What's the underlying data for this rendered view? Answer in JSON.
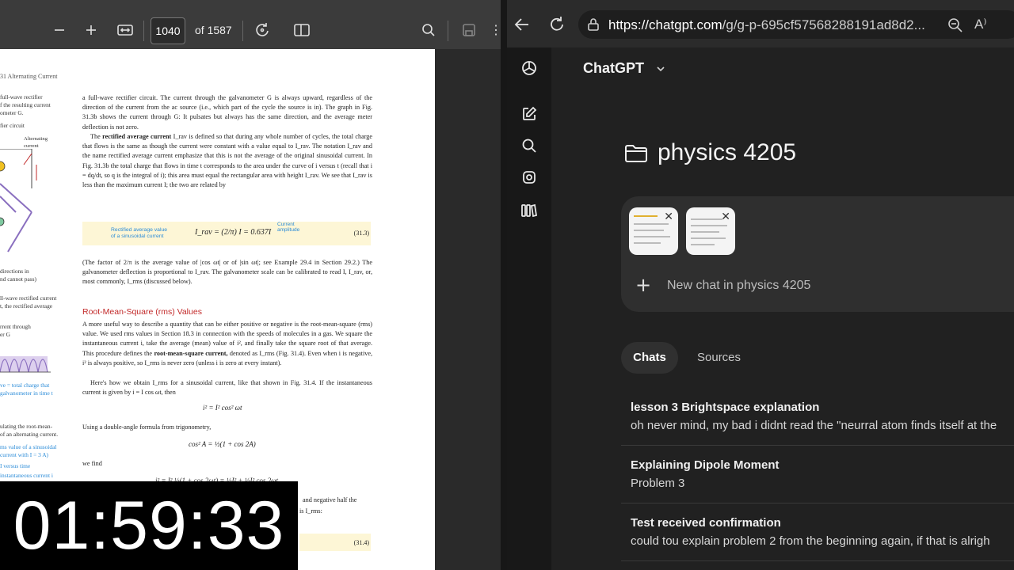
{
  "pdf_viewer": {
    "toolbar": {
      "zoom_out_icon": "minus-icon",
      "zoom_in_icon": "plus-icon",
      "fit_icon": "fit-width-icon",
      "current_page": "1040",
      "page_total": "of 1587",
      "rotate_icon": "rotate-icon",
      "two_page_icon": "book-view-icon",
      "search_icon": "search-icon",
      "save_icon": "save-icon",
      "more_icon": "more-icon"
    },
    "page": {
      "chapter_header": "31  Alternating Current",
      "left_column": [
        "full-wave rectifier",
        "f the resulting current",
        "ometer G.",
        "fier circuit",
        "Alternating",
        "current",
        "directions in",
        "nd cannot pass)",
        "ll-wave rectified current",
        "t, the rectified average",
        "rrent through",
        "er G",
        "ve = total charge that",
        "galvanometer in time t",
        "ulating the root-mean-",
        "of an alternating current.",
        "ms value of a sinusoidal",
        "current with I = 3 A)",
        "I versus time",
        "instantaneous current i"
      ],
      "para1": "a full-wave rectifier circuit. The current through the galvanometer G is always upward, regardless of the direction of the current from the ac source (i.e., which part of the cycle the source is in). The graph in Fig. 31.3b shows the current through G: It pulsates but always has the same direction, and the average meter deflection is not zero.",
      "para2_bold": "rectified average current",
      "para2_a": "The ",
      "para2_b": " I_rav is defined so that during any whole number of cycles, the total charge that flows is the same as though the current were constant with a value equal to I_rav. The notation I_rav and the name rectified average current emphasize that this is not the average of the original sinusoidal current. In Fig. 31.3b the total charge that flows in time t corresponds to the area under the curve of i versus t (recall that i = dq/dt, so q is the integral of i); this area must equal the rectangular area with height I_rav. We see that I_rav is less than the maximum current I; the two are related by",
      "eq1_label_line1": "Rectified average value",
      "eq1_label_line2": "of a sinusoidal current",
      "eq1_formula": "I_rav = (2/π) I = 0.637I",
      "eq1_note_line1": "Current",
      "eq1_note_line2": "amplitude",
      "eq1_number": "(31.3)",
      "para3": "(The factor of 2/π is the average value of |cos ωt| or of |sin ωt|; see Example 29.4 in Section 29.2.) The galvanometer deflection is proportional to I_rav. The galvanometer scale can be calibrated to read I, I_rav, or, most commonly, I_rms (discussed below).",
      "section_heading": "Root-Mean-Square (rms) Values",
      "para4_a": "A more useful way to describe a quantity that can be either positive or negative is the root-mean-square (rms) value. We used rms values in Section 18.3 in connection with the speeds of molecules in a gas. We square the instantaneous current i, take the average (mean) value of i², and finally take the square root of that average. This procedure defines the ",
      "para4_bold": "root-mean-square current,",
      "para4_b": " denoted as I_rms (Fig. 31.4). Even when i is negative, i² is always positive, so I_rms is never zero (unless i is zero at every instant).",
      "para5": "Here's how we obtain I_rms for a sinusoidal current, like that shown in Fig. 31.4. If the instantaneous current is given by i = I cos ωt, then",
      "eq2": "i² = I² cos² ωt",
      "para6": "Using a double-angle formula from trigonometry,",
      "eq3": "cos² A = ½(1 + cos 2A)",
      "para7": "we find",
      "eq4": "i² = I² ½(1 + cos 2ωt) = ½I² + ½I² cos 2ωt",
      "para8": "and negative half the",
      "para9": "is I_rms:",
      "eq5_number": "(31.4)"
    },
    "timer": "01:59:33"
  },
  "browser": {
    "back_icon": "back-arrow-icon",
    "reload_icon": "reload-icon",
    "site_info_icon": "site-info-icon",
    "url_host": "https://chatgpt.com",
    "url_path": "/g/g-p-695cf57568288191ad8d2...",
    "zoom_icon": "zoom-icon",
    "read_aloud_icon": "read-aloud-icon"
  },
  "chatgpt": {
    "model": "ChatGPT",
    "sidebar_icons": [
      "openai-logo-icon",
      "new-chat-icon",
      "search-icon",
      "gpts-icon",
      "library-icon"
    ],
    "project_title": "physics 4205",
    "new_chat_label": "New chat in physics 4205",
    "tabs": {
      "chats": "Chats",
      "sources": "Sources"
    },
    "chats": [
      {
        "title": "lesson 3 Brightspace explanation",
        "preview": "oh never mind, my bad i didnt read the \"neurral atom finds itself at the"
      },
      {
        "title": "Explaining Dipole Moment",
        "preview": "Problem 3"
      },
      {
        "title": "Test received confirmation",
        "preview": "could tou explain problem 2 from the beginning again, if that is alrigh"
      }
    ]
  }
}
